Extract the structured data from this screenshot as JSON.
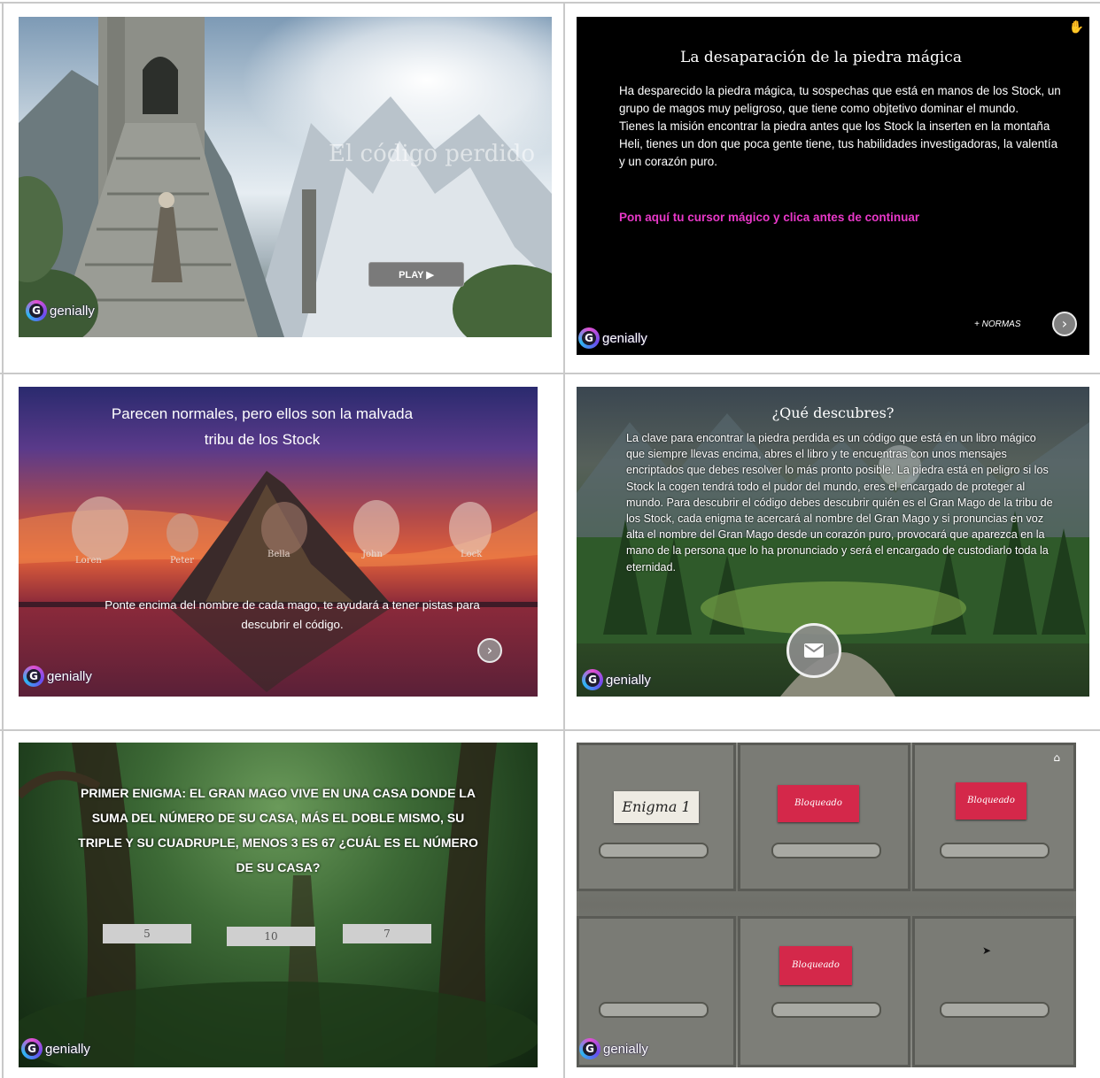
{
  "brand": "genially",
  "slide1": {
    "title": "El código perdido",
    "play_label": "PLAY ▶"
  },
  "slide2": {
    "title": "La desaparación de la piedra mágica",
    "paragraph1": "Ha desparecido la piedra mágica, tu sospechas que está en manos de los Stock, un grupo de magos muy peligroso, que tiene como objtetivo dominar el mundo.",
    "paragraph2": "Tienes la misión encontrar la piedra antes que los Stock la inserten en la montaña Heli, tienes un don que poca gente tiene, tus habilidades investigadoras, la valentía y un corazón puro.",
    "cta": "Pon aquí tu cursor mágico y clica antes de continuar",
    "normas": "+ NORMAS",
    "accent": "#e838c8"
  },
  "slide3": {
    "title": "Parecen normales, pero ellos son la malvada tribu de los Stock",
    "mages": [
      "Loren",
      "Peter",
      "Bella",
      "John",
      "Lock"
    ],
    "footer": "Ponte encima del nombre de cada mago, te ayudará a tener pistas para descubrir el código."
  },
  "slide4": {
    "title": "¿Qué descubres?",
    "body": "La clave para encontrar la piedra perdida es un código que está en un libro mágico que siempre llevas encima, abres el libro y te encuentras con unos mensajes encriptados que debes resolver lo más pronto posible. La piedra está en peligro si los Stock la cogen tendrá todo el pudor del mundo, eres el encargado de proteger al mundo. Para descubrir el código debes descubrir quién es el Gran Mago de la tribu de los Stock, cada enigma te acercará al nombre del Gran Mago y si pronuncias en voz alta el nombre del Gran Mago desde un corazón puro, provocará que aparezca en la mano de la persona que lo ha pronunciado y será el encargado de custodiarlo toda la eternidad."
  },
  "slide5": {
    "question": "PRIMER ENIGMA: EL GRAN MAGO VIVE EN UNA CASA DONDE LA SUMA DEL NÚMERO DE SU CASA, MÁS EL DOBLE MISMO, SU TRIPLE Y SU CUADRUPLE, MENOS 3 ES 67 ¿CUÁL ES EL NÚMERO DE SU CASA?",
    "options": [
      "5",
      "10",
      "7"
    ]
  },
  "slide6": {
    "drawer1_label": "Enigma 1",
    "locked_label": "Bloqueado"
  }
}
